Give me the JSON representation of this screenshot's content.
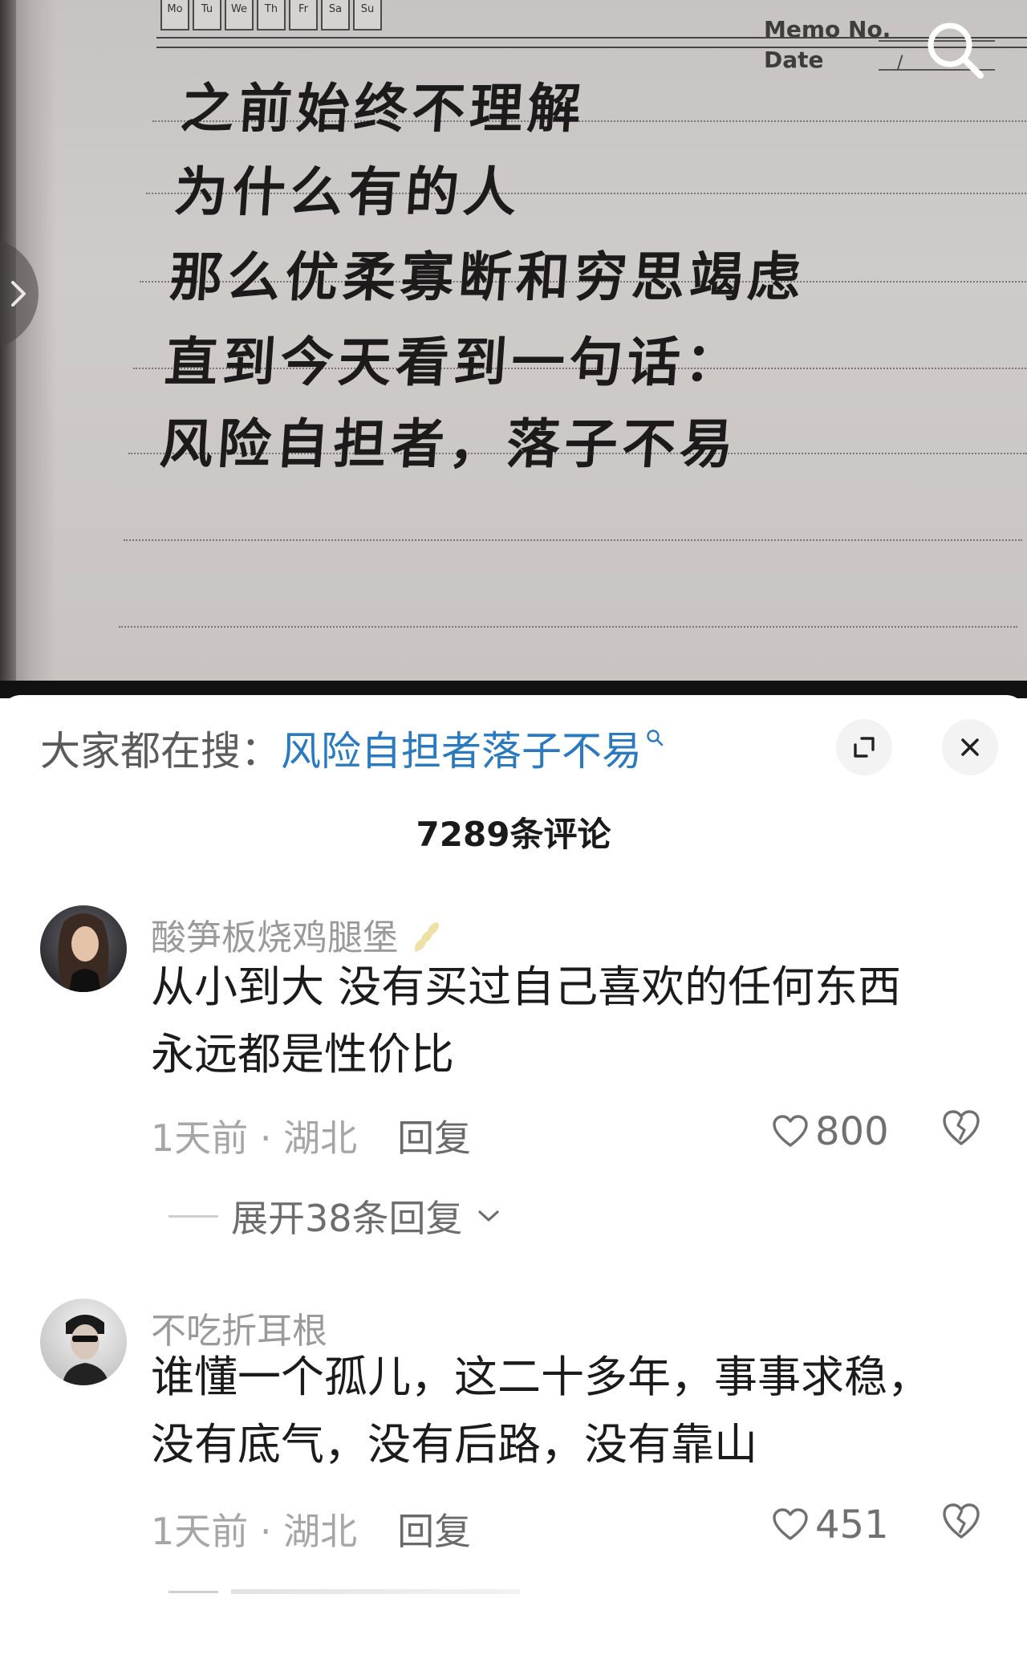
{
  "photo": {
    "day_labels": [
      "Mo",
      "Tu",
      "We",
      "Th",
      "Fr",
      "Sa",
      "Su"
    ],
    "memo_label": "Memo No.",
    "date_label": "Date",
    "date_slash": "/",
    "handwriting_lines": [
      "之前始终不理解",
      "为什么有的人",
      "那么优柔寡断和穷思竭虑",
      "直到今天看到一句话：",
      "风险自担者，落子不易"
    ]
  },
  "search_bar": {
    "prefix": "大家都在搜：",
    "term": "风险自担者落子不易",
    "term_icon": "search-icon"
  },
  "comments_header": {
    "count": "7289条评论"
  },
  "comments": [
    {
      "username": "酸笋板烧鸡腿堡",
      "badge_icon": "wheat-icon",
      "text_lines": [
        "从小到大 没有买过自己喜欢的任何东西",
        "永远都是性价比"
      ],
      "time_location": "1天前 · 湖北",
      "reply_label": "回复",
      "likes": "800",
      "expand_label": "展开38条回复"
    },
    {
      "username": "不吃折耳根",
      "text_lines": [
        "谁懂一个孤儿，这二十多年，事事求稳，",
        "没有底气，没有后路，没有靠山"
      ],
      "time_location": "1天前 · 湖北",
      "reply_label": "回复",
      "likes": "451"
    }
  ],
  "colors": {
    "accent_link": "#2a7ac0",
    "muted_text": "#9a9a9a",
    "paper": "#cfcbc9"
  }
}
